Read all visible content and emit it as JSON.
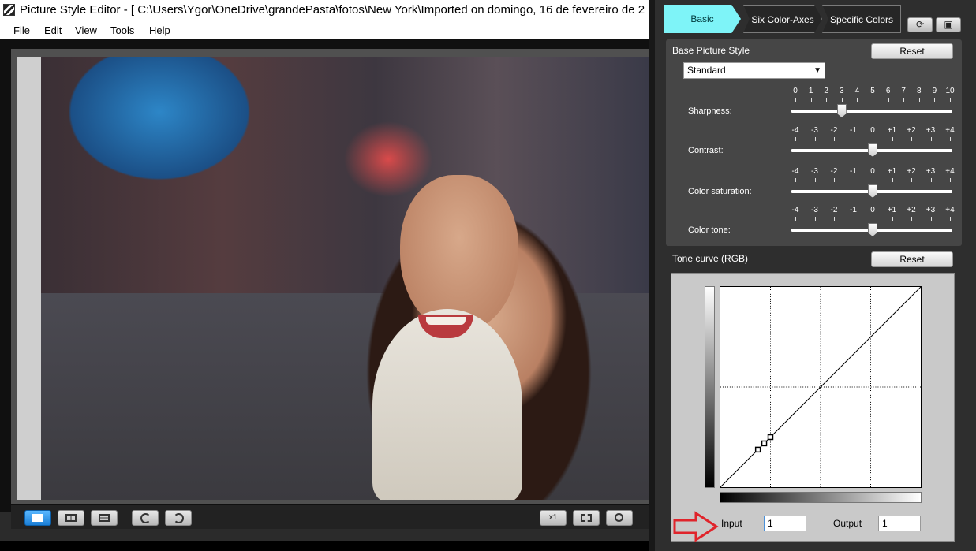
{
  "window": {
    "title": "Picture Style Editor - [ C:\\Users\\Ygor\\OneDrive\\grandePasta\\fotos\\New York\\Imported on domingo, 16 de fevereiro de 2"
  },
  "menu": [
    "File",
    "Edit",
    "View",
    "Tools",
    "Help"
  ],
  "viewer": {
    "zoom_button": "x1"
  },
  "tabs": [
    "Basic",
    "Six Color-Axes",
    "Specific Colors"
  ],
  "active_tab": "Basic",
  "base": {
    "title": "Base Picture Style",
    "reset": "Reset",
    "selected_style": "Standard"
  },
  "sliders": [
    {
      "label": "Sharpness:",
      "scale": [
        "0",
        "1",
        "2",
        "3",
        "4",
        "5",
        "6",
        "7",
        "8",
        "9",
        "10"
      ],
      "value": 3,
      "min": 0,
      "max": 10
    },
    {
      "label": "Contrast:",
      "scale": [
        "-4",
        "-3",
        "-2",
        "-1",
        "0",
        "+1",
        "+2",
        "+3",
        "+4"
      ],
      "value": 0,
      "min": -4,
      "max": 4
    },
    {
      "label": "Color saturation:",
      "scale": [
        "-4",
        "-3",
        "-2",
        "-1",
        "0",
        "+1",
        "+2",
        "+3",
        "+4"
      ],
      "value": 0,
      "min": -4,
      "max": 4
    },
    {
      "label": "Color tone:",
      "scale": [
        "-4",
        "-3",
        "-2",
        "-1",
        "0",
        "+1",
        "+2",
        "+3",
        "+4"
      ],
      "value": 0,
      "min": -4,
      "max": 4
    }
  ],
  "tone": {
    "title": "Tone curve (RGB)",
    "reset": "Reset",
    "input_label": "Input",
    "input_value": "1",
    "output_label": "Output",
    "output_value": "1",
    "points": [
      [
        48,
        48
      ],
      [
        56,
        56
      ],
      [
        64,
        64
      ]
    ],
    "accent_arrow_color": "#e0242b",
    "active_tab_color": "#7ef4f8"
  }
}
